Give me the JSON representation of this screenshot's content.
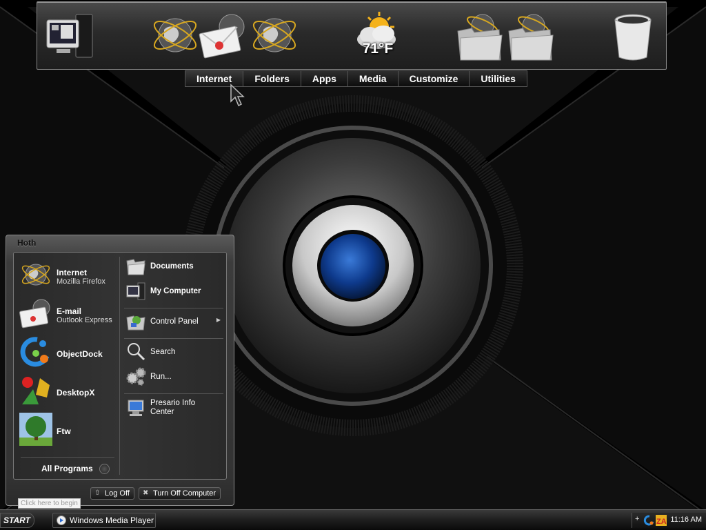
{
  "dock": {
    "icons": [
      {
        "name": "my-computer-icon"
      },
      {
        "name": "internet-globe-icon"
      },
      {
        "name": "email-icon"
      },
      {
        "name": "internet-globe-icon"
      },
      {
        "name": "weather-icon"
      },
      {
        "name": "folder-icon"
      },
      {
        "name": "folder-icon"
      },
      {
        "name": "recycle-bin-icon"
      }
    ],
    "weather_temp": "71°F",
    "tabs": [
      "Internet",
      "Folders",
      "Apps",
      "Media",
      "Customize",
      "Utilities"
    ],
    "selected_tab": "Internet"
  },
  "start_menu": {
    "user": "Hoth",
    "pinned": [
      {
        "title": "Internet",
        "subtitle": "Mozilla Firefox",
        "icon": "globe-icon"
      },
      {
        "title": "E-mail",
        "subtitle": "Outlook Express",
        "icon": "email-icon"
      },
      {
        "title": "ObjectDock",
        "subtitle": "",
        "icon": "objectdock-icon"
      },
      {
        "title": "DesktopX",
        "subtitle": "",
        "icon": "desktopx-icon"
      },
      {
        "title": "Ftw",
        "subtitle": "",
        "icon": "tree-icon"
      }
    ],
    "all_programs": "All Programs",
    "places": [
      {
        "label": "Documents",
        "icon": "documents-folder-icon"
      },
      {
        "label": "My Computer",
        "icon": "my-computer-icon"
      },
      {
        "label": "Control Panel",
        "icon": "control-panel-icon"
      },
      {
        "label": "Search",
        "icon": "search-icon"
      },
      {
        "label": "Run...",
        "icon": "run-gears-icon"
      },
      {
        "label": "Presario Info Center",
        "icon": "presario-info-icon"
      }
    ],
    "log_off": "Log Off",
    "turn_off": "Turn Off Computer"
  },
  "tooltip": "Click here to begin",
  "taskbar": {
    "start_label": "START",
    "tasks": [
      {
        "label": "Windows Media Player",
        "icon": "media-player-icon"
      }
    ],
    "tray_icons": [
      "objectdock-tray-icon",
      "zonealarm-icon"
    ],
    "clock": "11:16 AM"
  }
}
